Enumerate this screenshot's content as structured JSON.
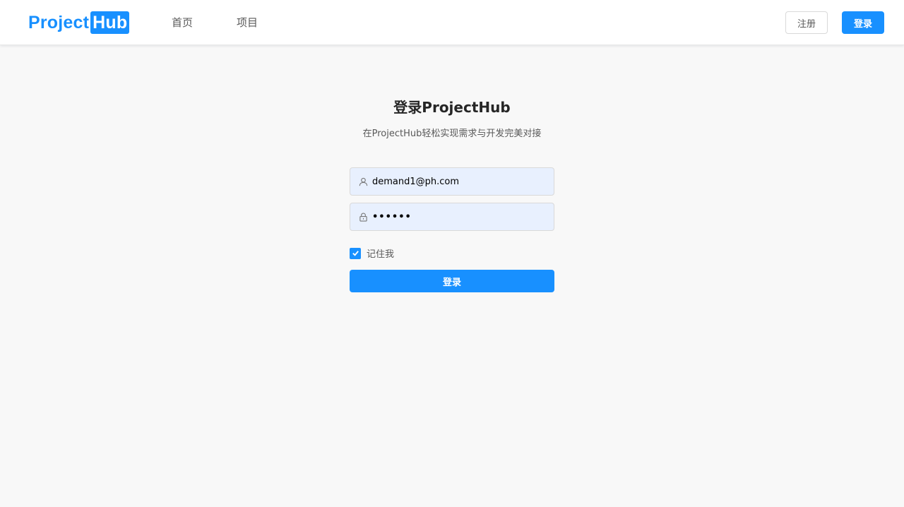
{
  "brand": {
    "logo_part1": "Project",
    "logo_part2": "Hub",
    "accent_color": "#1890ff"
  },
  "nav": {
    "items": [
      {
        "label": "首页"
      },
      {
        "label": "项目"
      }
    ]
  },
  "header_actions": {
    "register_label": "注册",
    "login_label": "登录"
  },
  "login_form": {
    "title": "登录ProjectHub",
    "subtitle": "在ProjectHub轻松实现需求与开发完美对接",
    "email": {
      "value": "demand1@ph.com",
      "icon": "user-icon"
    },
    "password": {
      "masked_value": "••••••",
      "icon": "lock-icon"
    },
    "remember": {
      "label": "记住我",
      "checked": true
    },
    "submit_label": "登录"
  }
}
